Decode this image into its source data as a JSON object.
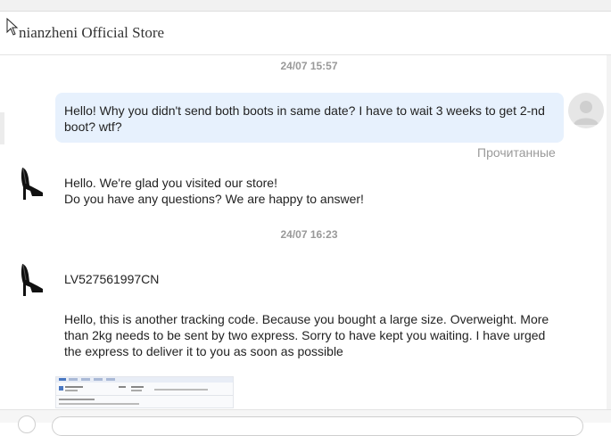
{
  "header": {
    "store_name": "nianzheni Official Store"
  },
  "messages": {
    "timestamp_1": "24/07 15:57",
    "outgoing_1": "Hello! Why you didn't send both boots in same date? I have to wait 3 weeks to get 2-nd boot? wtf?",
    "read_status": "Прочитанные",
    "incoming_1": "Hello. We're glad you visited our store!\nDo you have any questions? We are happy to answer!",
    "timestamp_2": "24/07 16:23",
    "incoming_2": "LV527561997CN",
    "incoming_3": "Hello, this is another tracking code. Because you bought a large size. Overweight. More than 2kg needs to be sent by two express. Sorry to have kept you waiting. I have urged the express to deliver it to you as soon as possible"
  },
  "icons": {
    "cursor": "mouse-pointer-icon",
    "user_avatar": "user-avatar-icon",
    "store_avatar": "high-heel-shoe-icon"
  },
  "colors": {
    "outgoing_bubble": "#e7f1fd",
    "timestamp": "#999999",
    "read_status": "#9a9a9a"
  }
}
